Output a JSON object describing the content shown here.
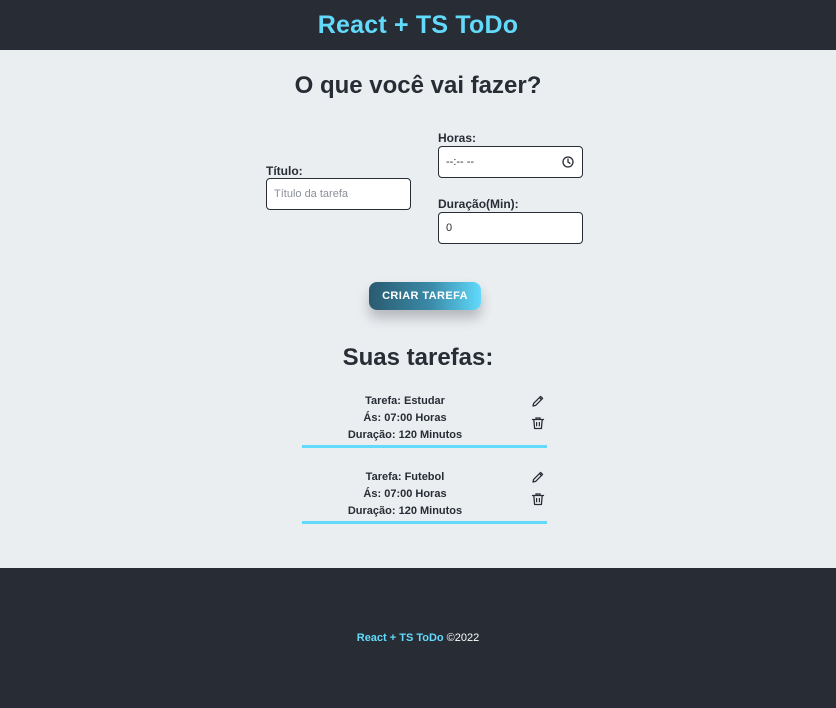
{
  "header": {
    "title": "React + TS ToDo"
  },
  "form": {
    "heading": "O que você vai fazer?",
    "title_label": "Título:",
    "title_placeholder": "Título da tarefa",
    "hours_label": "Horas:",
    "hours_value": "--:-- --",
    "duration_label": "Duração(Min):",
    "duration_value": "0",
    "submit_label": "CRIAR TAREFA"
  },
  "tasks": {
    "heading": "Suas tarefas:",
    "items": [
      {
        "title": "Tarefa: Estudar",
        "time": "Ás: 07:00 Horas",
        "duration": "Duração: 120 Minutos"
      },
      {
        "title": "Tarefa: Futebol",
        "time": "Ás: 07:00 Horas",
        "duration": "Duração: 120 Minutos"
      }
    ]
  },
  "footer": {
    "brand": "React + TS ToDo",
    "copyright": "©2022"
  },
  "colors": {
    "accent": "#61dafb",
    "dark": "#282c34",
    "background": "#ebeef1"
  },
  "icons": [
    "clock-icon",
    "edit-icon",
    "trash-icon"
  ]
}
